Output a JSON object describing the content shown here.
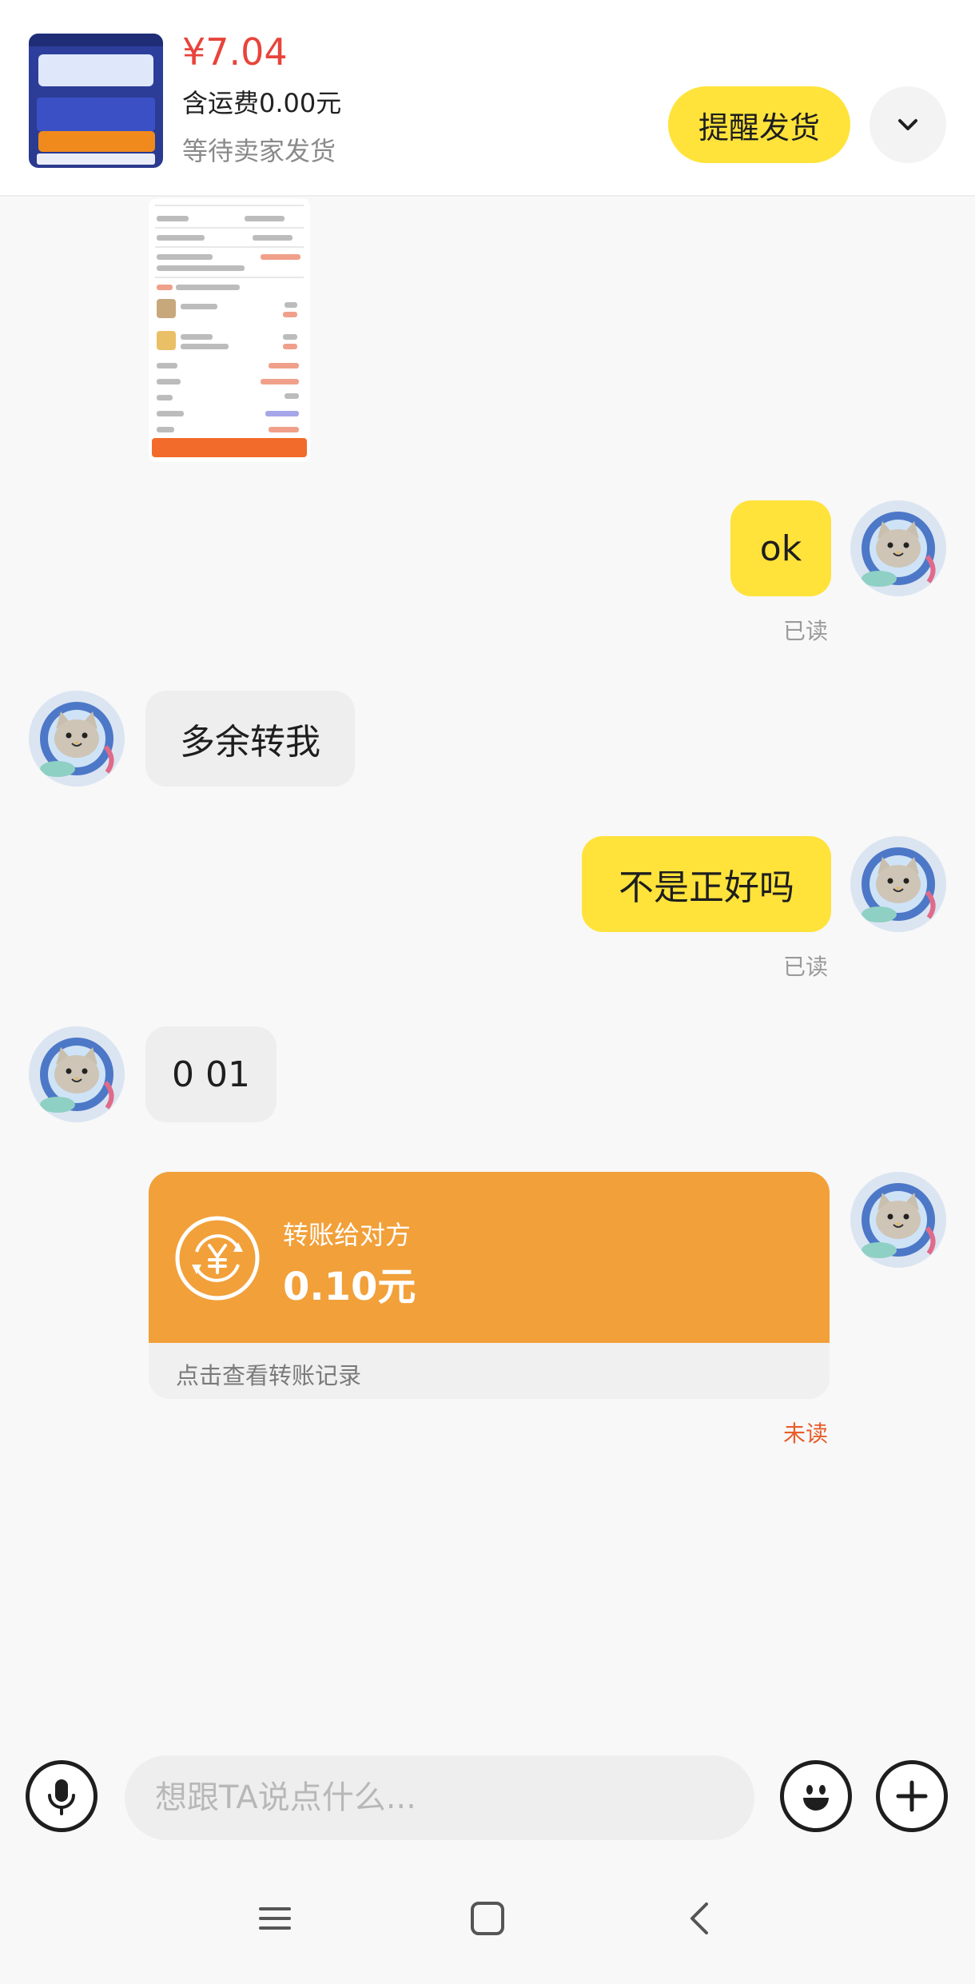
{
  "header": {
    "price": "¥7.04",
    "shipping": "含运费0.00元",
    "status": "等待卖家发货",
    "remind_button": "提醒发货",
    "thumbnail_icon": "product-thumbnail",
    "expand_icon": "chevron-down-icon"
  },
  "messages": [
    {
      "side": "me",
      "type": "text",
      "text": "ok",
      "status": "已读"
    },
    {
      "side": "them",
      "type": "text",
      "text": "多余转我"
    },
    {
      "side": "me",
      "type": "text",
      "text": "不是正好吗",
      "status": "已读"
    },
    {
      "side": "them",
      "type": "text",
      "text": "0 01"
    }
  ],
  "transfer": {
    "title": "转账给对方",
    "amount": "0.10元",
    "link": "点击查看转账记录",
    "status": "未读",
    "accent_color": "#f2a03a"
  },
  "input": {
    "placeholder": "想跟TA说点什么..."
  },
  "colors": {
    "my_bubble": "#ffe33b",
    "their_bubble": "#eeeeee",
    "price": "#e8443a",
    "unread": "#e85d2a"
  },
  "nav": {
    "items": [
      "menu-icon",
      "home-icon",
      "back-icon"
    ]
  }
}
